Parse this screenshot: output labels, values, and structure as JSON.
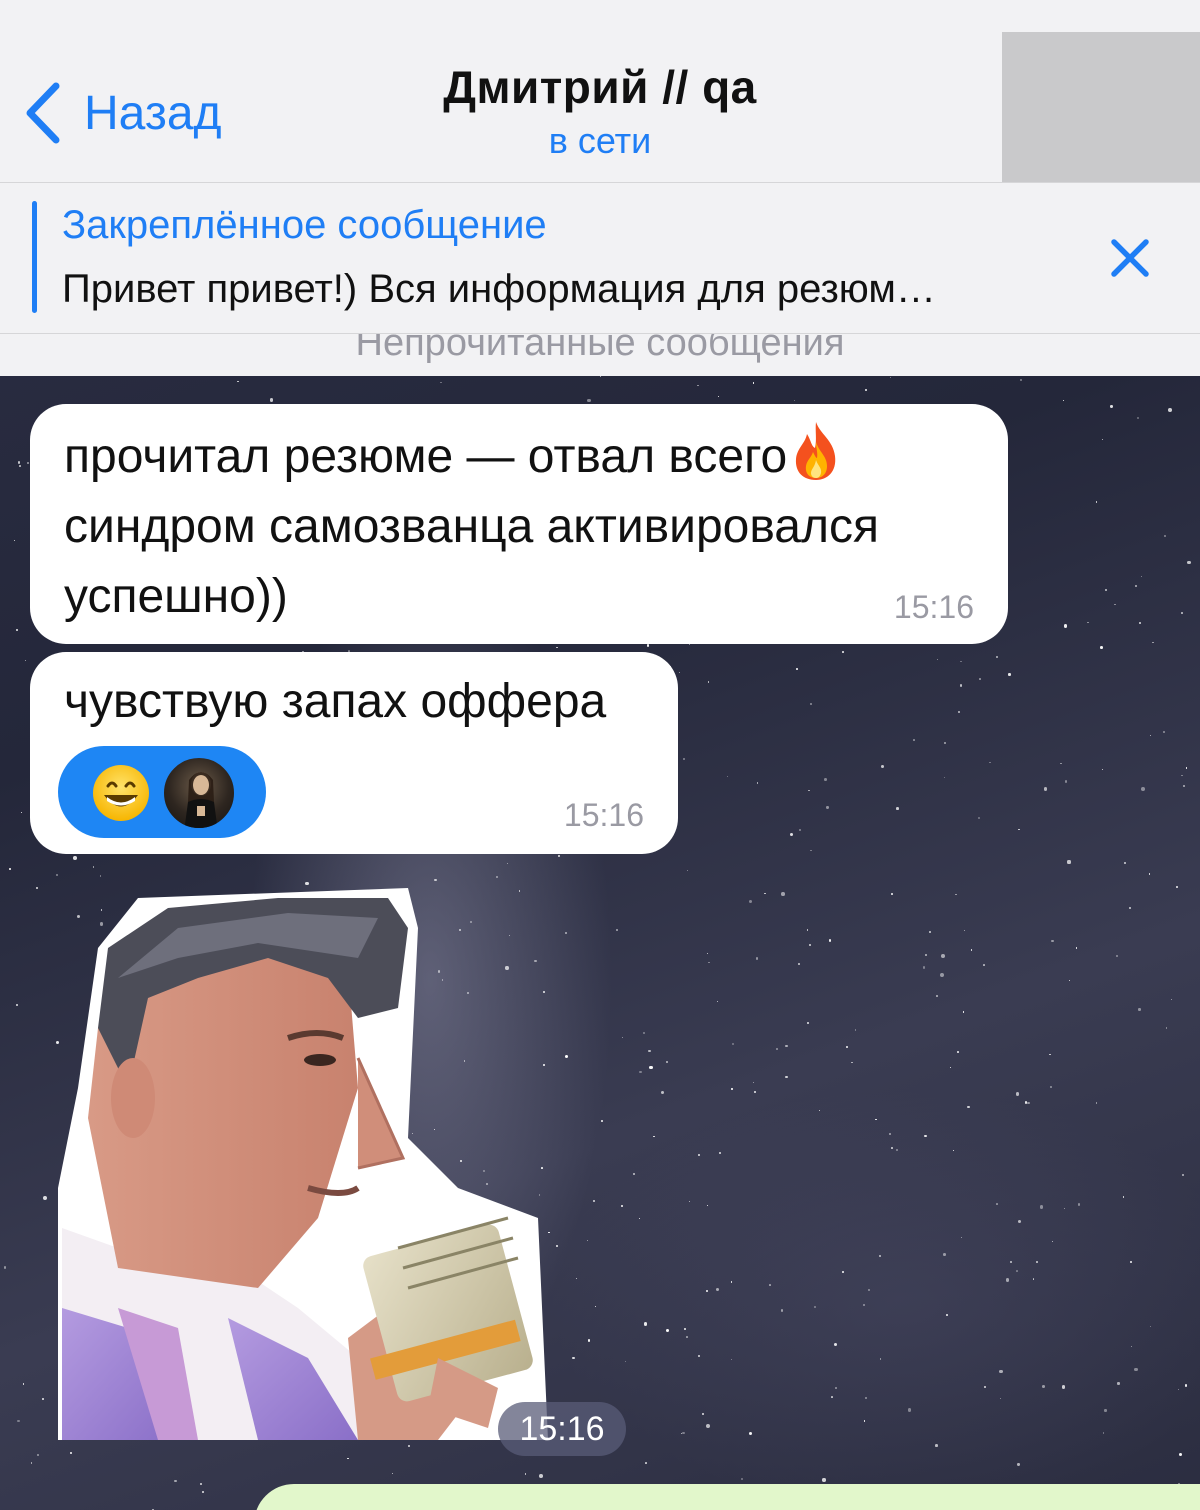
{
  "header": {
    "back_label": "Назад",
    "title": "Дмитрий // qa",
    "status": "в сети"
  },
  "pinned": {
    "title": "Закреплённое сообщение",
    "text": "Привет привет!) Вся информация для резюм…"
  },
  "unread_label": "Непрочитанные сообщения",
  "messages": [
    {
      "lines": [
        "прочитал резюме — отвал всего",
        "синдром самозванца активировался",
        "успешно))"
      ],
      "emoji": "fire-emoji",
      "time": "15:16"
    },
    {
      "text": "чувствую запах оффера",
      "reaction": "grinning-face-emoji",
      "time": "15:16"
    },
    {
      "type": "sticker",
      "time": "15:16"
    }
  ],
  "colors": {
    "accent": "#1f7ef5",
    "header_bg": "#f2f2f4",
    "bubble_in": "#ffffff",
    "bubble_out": "#e2f7cb",
    "reaction_bg": "#1e86f4"
  }
}
